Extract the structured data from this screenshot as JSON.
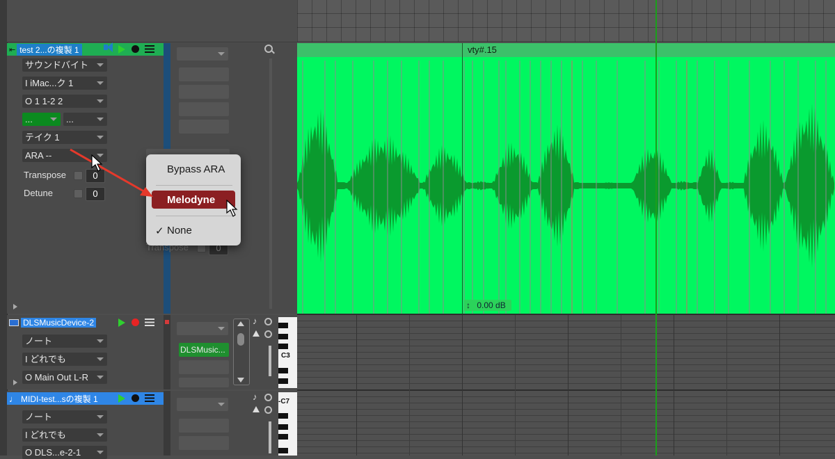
{
  "audio_track": {
    "name": "test 2...の複製 1",
    "input_type": "サウンドバイト",
    "input": "I  iMac...ク 1",
    "output": "O 1 1-2 2",
    "slot_a": "...",
    "slot_b": "...",
    "take": "テイク 1",
    "ara": "ARA --",
    "transpose_label": "Transpose",
    "transpose_value": "0",
    "detune_label": "Detune",
    "detune_value": "0",
    "ghost_transpose": "Transpose",
    "ghost_value": "0"
  },
  "ara_menu": {
    "items": [
      "Bypass ARA",
      "Melodyne",
      "None"
    ],
    "checked": "None",
    "highlighted": "Melodyne",
    "check_mark": "✓"
  },
  "region": {
    "name": "vty#.15",
    "gain": "0.00 dB",
    "gain_icon": "↕"
  },
  "midi_track_1": {
    "name": "DLSMusicDevice-2",
    "type": "ノート",
    "input": "I  どれでも",
    "output": "O Main Out L-R",
    "instrument": "DLSMusic...",
    "piano_label": "C3"
  },
  "midi_track_2": {
    "name": "MIDI-test...sの複製 1",
    "type": "ノート",
    "input": "I  どれでも",
    "output": "O DLS...e-2-1",
    "piano_label": "-C7"
  },
  "colors": {
    "audio_header": "#1fae53",
    "waveform_bg": "#00f760",
    "waveform": "#0a9a2e",
    "selected_track": "#2f86e6",
    "playhead": "#1aa01a",
    "menu_highlight": "#8b1f22",
    "arrow": "#e5392b"
  }
}
